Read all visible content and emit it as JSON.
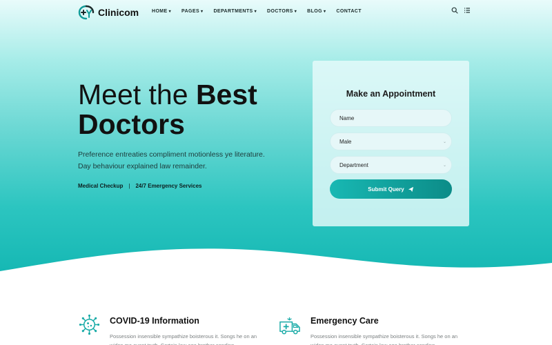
{
  "brand": {
    "name": "Clinicom"
  },
  "nav": [
    {
      "label": "HOME",
      "dropdown": true
    },
    {
      "label": "PAGES",
      "dropdown": true
    },
    {
      "label": "DEPARTMENTS",
      "dropdown": true
    },
    {
      "label": "DOCTORS",
      "dropdown": true
    },
    {
      "label": "BLOG",
      "dropdown": true
    },
    {
      "label": "CONTACT",
      "dropdown": false
    }
  ],
  "header_icons": [
    "search-icon",
    "menu-icon"
  ],
  "hero": {
    "title_light": "Meet the ",
    "title_bold_1": "Best",
    "title_bold_2": "Doctors",
    "lead": "Preference entreaties compliment motionless ye literature. Day behaviour explained law remainder.",
    "tags": [
      "Medical Checkup",
      "24/7 Emergency Services"
    ],
    "separator": "|"
  },
  "appointment": {
    "title": "Make an Appointment",
    "name_placeholder": "Name",
    "gender_value": "Male",
    "department_value": "Department",
    "submit_label": "Submit Query"
  },
  "services": [
    {
      "icon": "virus-icon",
      "title": "COVID-19 Information",
      "text": "Possession insensible sympathize boisterous it. Songs he on an widen me event truth. Certain law age brother sending."
    },
    {
      "icon": "ambulance-icon",
      "title": "Emergency Care",
      "text": "Possession insensible sympathize boisterous it. Songs he on an widen me event truth. Certain law age brother sending."
    }
  ],
  "colors": {
    "accent": "#14b7b3",
    "accent_dark": "#0c8c88",
    "text_dark": "#111111",
    "text_muted": "#7a7f80"
  }
}
